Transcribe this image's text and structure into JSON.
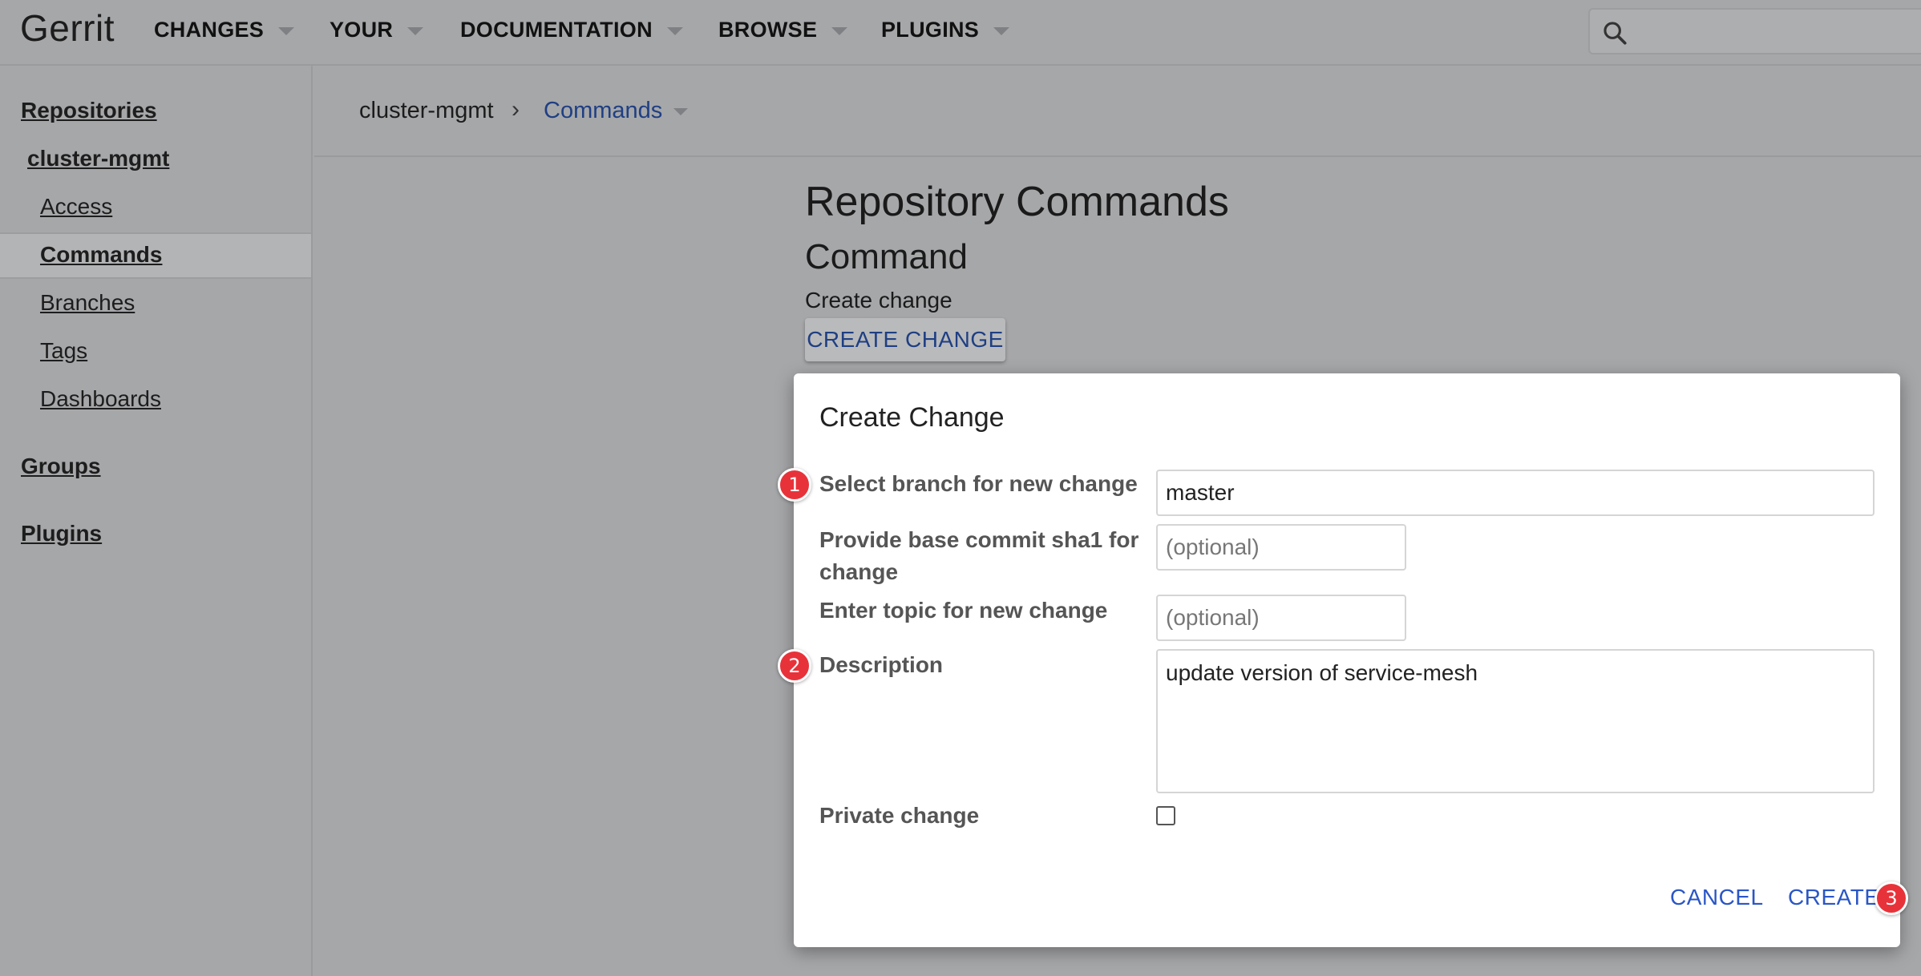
{
  "header": {
    "logo": "Gerrit",
    "menus": [
      "CHANGES",
      "YOUR",
      "DOCUMENTATION",
      "BROWSE",
      "PLUGINS"
    ],
    "search_icon": "search-icon"
  },
  "sidebar": {
    "repositories": "Repositories",
    "repo_name": "cluster-mgmt",
    "items": [
      "Access",
      "Commands",
      "Branches",
      "Tags",
      "Dashboards"
    ],
    "active_item": "Commands",
    "groups": "Groups",
    "plugins": "Plugins"
  },
  "breadcrumb": {
    "repo": "cluster-mgmt",
    "separator": "›",
    "current": "Commands"
  },
  "main": {
    "title": "Repository Commands",
    "section": "Command",
    "command_label": "Create change",
    "command_button": "CREATE CHANGE"
  },
  "dialog": {
    "title": "Create Change",
    "branch_label": "Select branch for new change",
    "branch_value": "master",
    "base_label": "Provide base commit sha1 for change",
    "base_placeholder": "(optional)",
    "topic_label": "Enter topic for new change",
    "topic_placeholder": "(optional)",
    "description_label": "Description",
    "description_value": "update version of service-mesh",
    "private_label": "Private change",
    "private_checked": false,
    "cancel": "CANCEL",
    "create": "CREATE"
  },
  "annotations": [
    "1",
    "2",
    "3"
  ],
  "colors": {
    "overlay_bg": "#a6a7a9",
    "link_blue": "#2a56c6",
    "badge_red": "#e8323a"
  }
}
